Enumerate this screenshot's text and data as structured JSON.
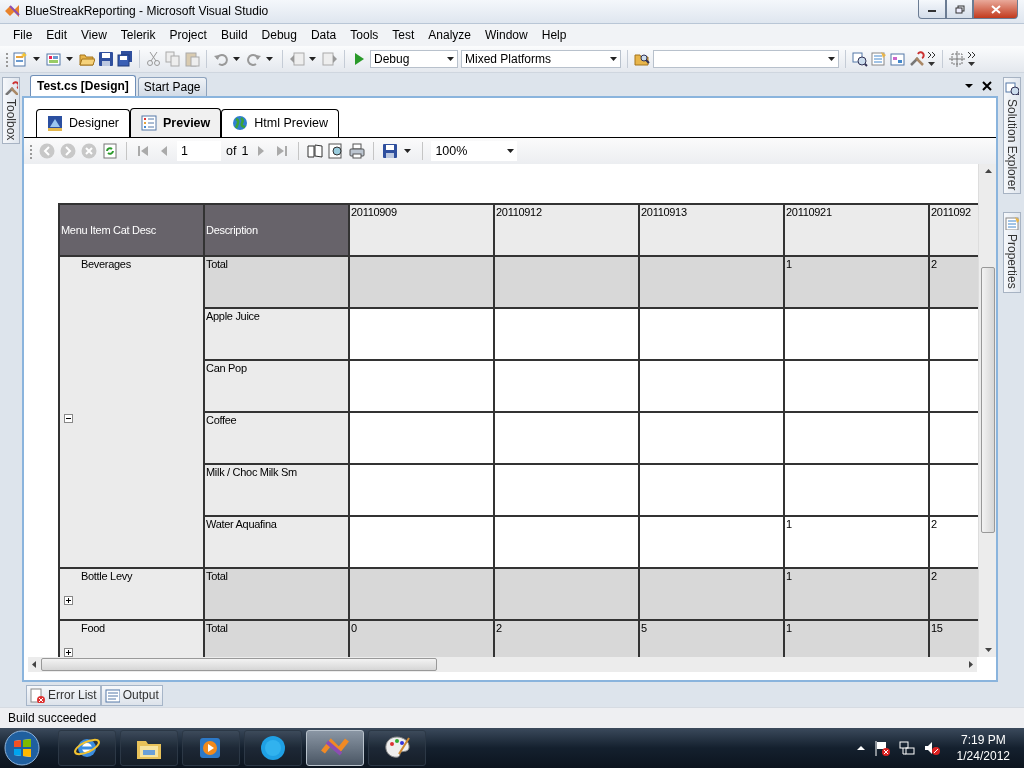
{
  "window": {
    "title": "BlueStreakReporting - Microsoft Visual Studio"
  },
  "menu": [
    "File",
    "Edit",
    "View",
    "Telerik",
    "Project",
    "Build",
    "Debug",
    "Data",
    "Tools",
    "Test",
    "Analyze",
    "Window",
    "Help"
  ],
  "toolbar": {
    "configuration": "Debug",
    "platform": "Mixed Platforms"
  },
  "left_side_tabs": [
    "Toolbox"
  ],
  "right_side_tabs": [
    "Solution Explorer",
    "Properties"
  ],
  "document_tabs": [
    {
      "label": "Test.cs [Design]",
      "selected": true
    },
    {
      "label": "Start Page",
      "selected": false
    }
  ],
  "view_tabs": [
    {
      "label": "Designer",
      "selected": false
    },
    {
      "label": "Preview",
      "selected": true
    },
    {
      "label": "Html Preview",
      "selected": false
    }
  ],
  "report_toolbar": {
    "page": "1",
    "of_label": "of",
    "page_count": "1",
    "zoom": "100%"
  },
  "table": {
    "columns": [
      "Menu Item Cat Desc",
      "Description",
      "20110909",
      "20110912",
      "20110913",
      "20110921",
      "2011092"
    ],
    "groups": [
      {
        "name": "Beverages",
        "expanded": true,
        "rows": [
          {
            "kind": "total",
            "description": "Total",
            "values": {
              "column_6": "1",
              "column_7": "2"
            }
          },
          {
            "kind": "detail",
            "description": "Apple Juice"
          },
          {
            "kind": "detail",
            "description": "Can Pop"
          },
          {
            "kind": "detail",
            "description": "Coffee"
          },
          {
            "kind": "detail",
            "description": "Milk / Choc Milk Sm"
          },
          {
            "kind": "detail",
            "description": "Water Aquafina",
            "values": {
              "column_6": "1",
              "column_7": "2"
            }
          }
        ]
      },
      {
        "name": "Bottle Levy",
        "expanded": false,
        "rows": [
          {
            "kind": "total",
            "description": "Total",
            "values": {
              "column_6": "1",
              "column_7": "2"
            }
          }
        ]
      },
      {
        "name": "Food",
        "expanded": false,
        "rows": [
          {
            "kind": "total",
            "description": "Total",
            "values": {
              "column_3": "0",
              "column_4": "2",
              "column_5": "5",
              "column_6": "1",
              "column_7": "15"
            }
          }
        ]
      }
    ]
  },
  "bottom_tabs": [
    "Error List",
    "Output"
  ],
  "status_bar": "Build succeeded",
  "taskbar": {
    "apps": [
      {
        "active": false
      },
      {
        "active": false
      },
      {
        "active": false
      },
      {
        "active": false
      },
      {
        "active": true
      },
      {
        "active": false
      }
    ],
    "time": "7:19 PM",
    "date": "1/24/2012"
  }
}
